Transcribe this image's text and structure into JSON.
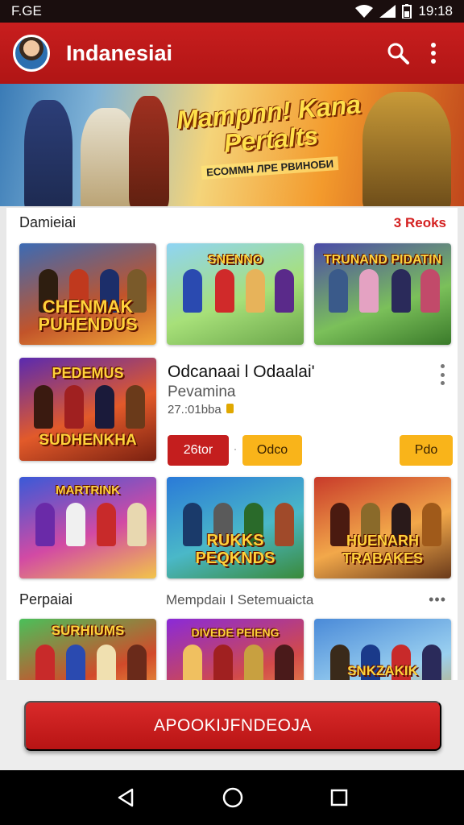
{
  "status_bar": {
    "left_text": "F.GЕ",
    "time": "19:18"
  },
  "app_bar": {
    "title": "Indanesiai"
  },
  "banner": {
    "title": "Mampnn! Kana Pertalts",
    "subtitle": "ЕСОММН ЛРЕ РВИНОБИ"
  },
  "section1": {
    "title": "Damieiai",
    "action": "3 Reoks"
  },
  "row1": [
    {
      "label": "CHENMAK PUHENDUS"
    },
    {
      "label": "SNENNO"
    },
    {
      "label": "TRUNAND PIDATIN"
    }
  ],
  "featured": {
    "tile_label": "SUDHENKHA",
    "tile_top_label": "PEDEMUS",
    "title": "Odcanaai l Odaalai'",
    "subtitle": "Pevamina",
    "meta": "27.:01bba",
    "button1": "26tor",
    "button2": "Odco",
    "button3": "Pdo"
  },
  "row2": [
    {
      "label": "MARTRINK"
    },
    {
      "label": "RUKKS PEQKNDS"
    },
    {
      "label": "HUENARH TRABAKES"
    }
  ],
  "section2": {
    "title": "Perpaiai",
    "middle": "Mempdaiı I   Setemuaicta"
  },
  "row3": [
    {
      "label": "SURHIUMS"
    },
    {
      "label": "DIVEDE PEIENG"
    },
    {
      "label": "SNKZAKIK"
    }
  ],
  "cta": {
    "label": "APOOKIJFNDEOJA"
  },
  "colors": {
    "primary": "#c41e1e",
    "accent": "#f9b41a"
  }
}
